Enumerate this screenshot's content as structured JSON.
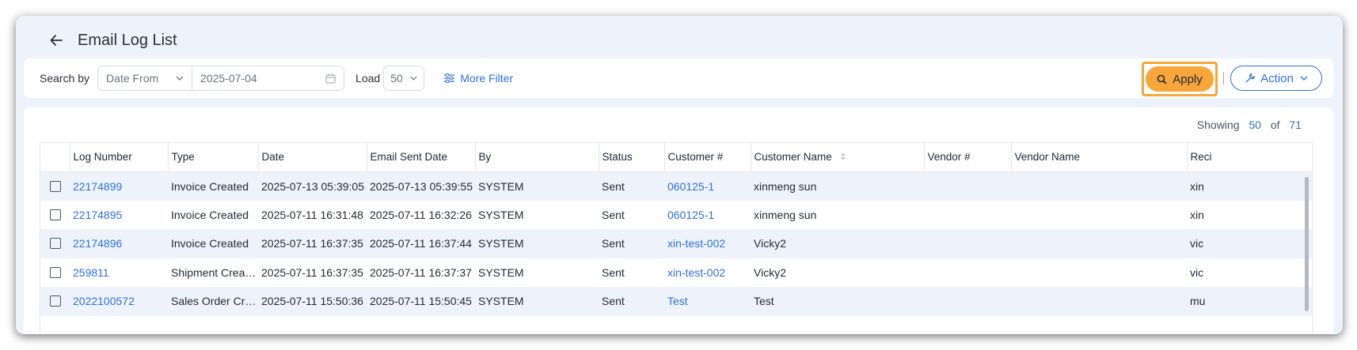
{
  "header": {
    "title": "Email Log List"
  },
  "filters": {
    "search_by_label": "Search by",
    "search_by_value": "Date From",
    "date_value": "2025-07-04",
    "load_label": "Load",
    "load_value": "50",
    "more_filter_label": "More Filter",
    "apply_label": "Apply",
    "action_label": "Action"
  },
  "summary": {
    "showing_label": "Showing",
    "shown": "50",
    "of_label": "of",
    "total": "71"
  },
  "table": {
    "columns": [
      "Log Number",
      "Type",
      "Date",
      "Email Sent Date",
      "By",
      "Status",
      "Customer #",
      "Customer Name",
      "Vendor #",
      "Vendor Name",
      "Reci"
    ],
    "rows": [
      {
        "log": "22174899",
        "type": "Invoice Created",
        "date": "2025-07-13 05:39:05",
        "sent": "2025-07-13 05:39:55",
        "by": "SYSTEM",
        "status": "Sent",
        "cust_no": "060125-1",
        "cust_name": "xinmeng sun",
        "vendor_no": "",
        "vendor_name": "",
        "recipient": "xin"
      },
      {
        "log": "22174895",
        "type": "Invoice Created",
        "date": "2025-07-11 16:31:48",
        "sent": "2025-07-11 16:32:26",
        "by": "SYSTEM",
        "status": "Sent",
        "cust_no": "060125-1",
        "cust_name": "xinmeng sun",
        "vendor_no": "",
        "vendor_name": "",
        "recipient": "xin"
      },
      {
        "log": "22174896",
        "type": "Invoice Created",
        "date": "2025-07-11 16:37:35",
        "sent": "2025-07-11 16:37:44",
        "by": "SYSTEM",
        "status": "Sent",
        "cust_no": "xin-test-002",
        "cust_name": "Vicky2",
        "vendor_no": "",
        "vendor_name": "",
        "recipient": "vic"
      },
      {
        "log": "259811",
        "type": "Shipment Created",
        "date": "2025-07-11 16:37:35",
        "sent": "2025-07-11 16:37:37",
        "by": "SYSTEM",
        "status": "Sent",
        "cust_no": "xin-test-002",
        "cust_name": "Vicky2",
        "vendor_no": "",
        "vendor_name": "",
        "recipient": "vic"
      },
      {
        "log": "2022100572",
        "type": "Sales Order Crea...",
        "date": "2025-07-11 15:50:36",
        "sent": "2025-07-11 15:50:45",
        "by": "SYSTEM",
        "status": "Sent",
        "cust_no": "Test",
        "cust_name": "Test",
        "vendor_no": "",
        "vendor_name": "",
        "recipient": "mu"
      }
    ]
  }
}
